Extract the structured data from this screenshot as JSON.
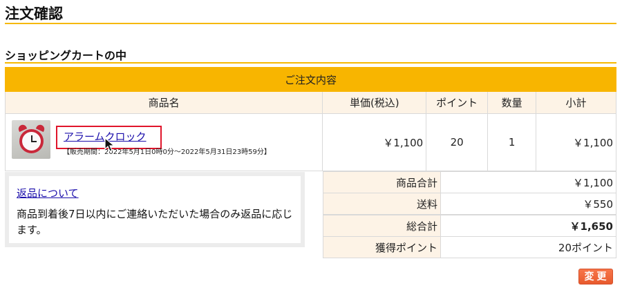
{
  "page": {
    "title": "注文確認"
  },
  "cart": {
    "section_title": "ショッピングカートの中",
    "caption": "ご注文内容",
    "columns": [
      "商品名",
      "単価(税込)",
      "ポイント",
      "数量",
      "小計"
    ],
    "items": [
      {
        "thumbnail": "alarm-clock-image",
        "name": "アラームクロック",
        "sale_period": "【販売期間：2022年5月1日0時0分〜2022年5月31日23時59分】",
        "unit_price": "￥1,100",
        "points": "20",
        "quantity": "1",
        "subtotal": "￥1,100"
      }
    ]
  },
  "returns": {
    "link_label": "返品について",
    "text": "商品到着後7日以内にご連絡いただいた場合のみ返品に応じます。"
  },
  "summary": {
    "items_total_label": "商品合計",
    "items_total": "￥1,100",
    "shipping_label": "送料",
    "shipping": "￥550",
    "grand_total_label": "総合計",
    "grand_total": "￥1,650",
    "points_label": "獲得ポイント",
    "points": "20ポイント"
  },
  "actions": {
    "change_label": "変更"
  },
  "colors": {
    "accent": "#f8b500",
    "header_bg": "#fdf3e6",
    "highlight": "#e0142a",
    "button": "#e85a2d"
  }
}
